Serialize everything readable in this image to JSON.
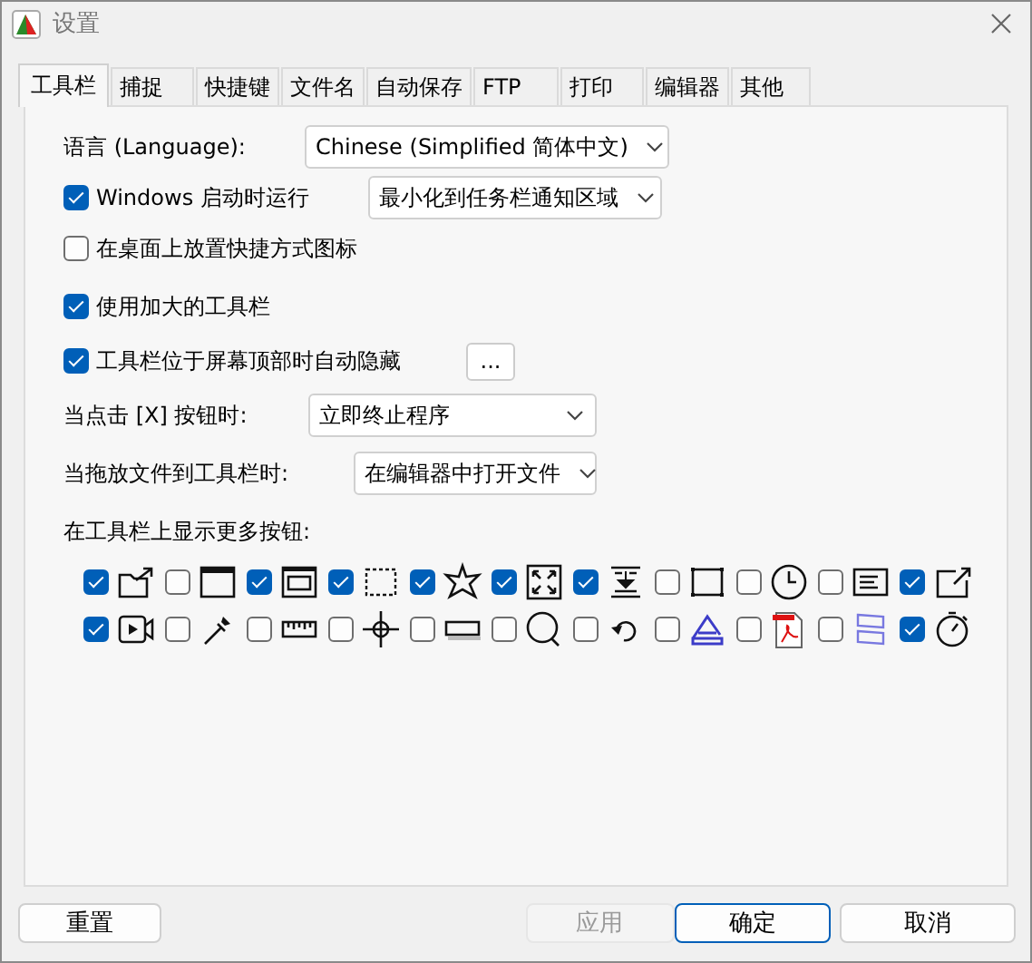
{
  "window": {
    "title": "设置"
  },
  "tabs": [
    {
      "label": "工具栏",
      "selected": true
    },
    {
      "label": "捕捉",
      "selected": false
    },
    {
      "label": "快捷键",
      "selected": false
    },
    {
      "label": "文件名",
      "selected": false
    },
    {
      "label": "自动保存",
      "selected": false
    },
    {
      "label": "FTP",
      "selected": false
    },
    {
      "label": "打印",
      "selected": false
    },
    {
      "label": "编辑器",
      "selected": false
    },
    {
      "label": "其他",
      "selected": false
    }
  ],
  "language": {
    "label": "语言 (Language):",
    "value": "Chinese (Simplified 简体中文)"
  },
  "run_at_startup": {
    "label": "Windows 启动时运行",
    "checked": true,
    "value": "最小化到任务栏通知区域"
  },
  "options": [
    {
      "label": "在桌面上放置快捷方式图标",
      "checked": false
    },
    {
      "label": "使用加大的工具栏",
      "checked": true
    },
    {
      "label": "工具栏位于屏幕顶部时自动隐藏",
      "checked": true,
      "button": "..."
    }
  ],
  "close_action": {
    "label": "当点击 [X] 按钮时:",
    "value": "立即终止程序"
  },
  "drop_action": {
    "label": "当拖放文件到工具栏时:",
    "value": "在编辑器中打开文件"
  },
  "more_buttons": {
    "label": "在工具栏上显示更多按钮:",
    "items": [
      {
        "checked": true
      },
      {
        "checked": false
      },
      {
        "checked": true
      },
      {
        "checked": true
      },
      {
        "checked": true
      },
      {
        "checked": true
      },
      {
        "checked": true
      },
      {
        "checked": false
      },
      {
        "checked": false
      },
      {
        "checked": false
      },
      {
        "checked": true
      },
      {
        "checked": true
      },
      {
        "checked": false
      },
      {
        "checked": false
      },
      {
        "checked": false
      },
      {
        "checked": false
      },
      {
        "checked": false
      },
      {
        "checked": false
      },
      {
        "checked": false
      },
      {
        "checked": false
      },
      {
        "checked": false
      },
      {
        "checked": true
      }
    ]
  },
  "footer_buttons": [
    {
      "label": "重置",
      "disabled": false,
      "default": false
    },
    {
      "label": "应用",
      "disabled": true,
      "default": false
    },
    {
      "label": "确定",
      "disabled": false,
      "default": true
    },
    {
      "label": "取消",
      "disabled": false,
      "default": false
    }
  ]
}
